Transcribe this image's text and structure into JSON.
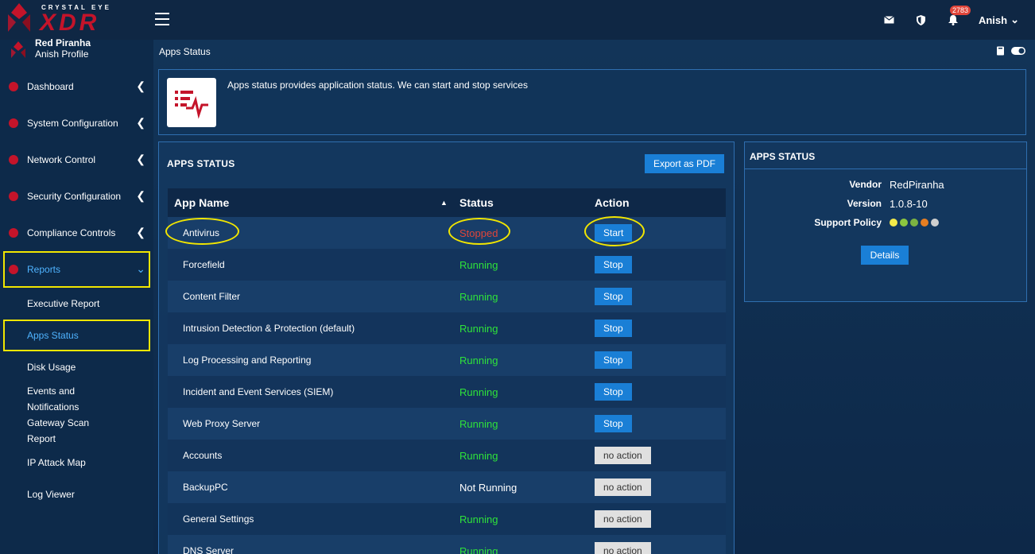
{
  "brand": {
    "tagline": "CRYSTAL EYE",
    "name": "XDR"
  },
  "topbar": {
    "notification_count": "2783",
    "user": "Anish"
  },
  "profile": {
    "name": "Red Piranha",
    "sub": "Anish Profile"
  },
  "sidebar": {
    "items": [
      {
        "label": "Dashboard"
      },
      {
        "label": "System Configuration"
      },
      {
        "label": "Network Control"
      },
      {
        "label": "Security Configuration"
      },
      {
        "label": "Compliance Controls"
      },
      {
        "label": "Reports"
      }
    ],
    "sub_items": [
      {
        "label": "Executive Report"
      },
      {
        "label": "Apps Status"
      },
      {
        "label": "Disk Usage"
      },
      {
        "label": "Events and Notifications"
      },
      {
        "label": "Gateway Scan Report"
      },
      {
        "label": "IP Attack Map"
      },
      {
        "label": "Log Viewer"
      }
    ]
  },
  "breadcrumb": "Apps Status",
  "info": {
    "text": "Apps status provides application status. We can start and stop services"
  },
  "main": {
    "title": "APPS STATUS",
    "export_label": "Export as PDF",
    "headers": {
      "name": "App Name",
      "status": "Status",
      "action": "Action"
    },
    "rows": [
      {
        "name": "Antivirus",
        "status": "Stopped",
        "action": "Start"
      },
      {
        "name": "Forcefield",
        "status": "Running",
        "action": "Stop"
      },
      {
        "name": "Content Filter",
        "status": "Running",
        "action": "Stop"
      },
      {
        "name": "Intrusion Detection & Protection (default)",
        "status": "Running",
        "action": "Stop"
      },
      {
        "name": "Log Processing and Reporting",
        "status": "Running",
        "action": "Stop"
      },
      {
        "name": "Incident and Event Services (SIEM)",
        "status": "Running",
        "action": "Stop"
      },
      {
        "name": "Web Proxy Server",
        "status": "Running",
        "action": "Stop"
      },
      {
        "name": "Accounts",
        "status": "Running",
        "action": "no action"
      },
      {
        "name": "BackupPC",
        "status": "Not Running",
        "action": "no action"
      },
      {
        "name": "General Settings",
        "status": "Running",
        "action": "no action"
      },
      {
        "name": "DNS Server",
        "status": "Running",
        "action": "no action"
      }
    ]
  },
  "side": {
    "title": "APPS STATUS",
    "vendor_label": "Vendor",
    "vendor": "RedPiranha",
    "version_label": "Version",
    "version": "1.0.8-10",
    "support_label": "Support Policy",
    "support_colors": [
      "#f2ea4a",
      "#8cc63f",
      "#7cb342",
      "#e67e22",
      "#cfcfcf"
    ],
    "details_label": "Details"
  },
  "colors": {
    "accent": "#1a7fd6",
    "brand": "#c4142a",
    "running": "#2ee23a",
    "stopped": "#e0453a",
    "highlight": "#f2e600"
  }
}
